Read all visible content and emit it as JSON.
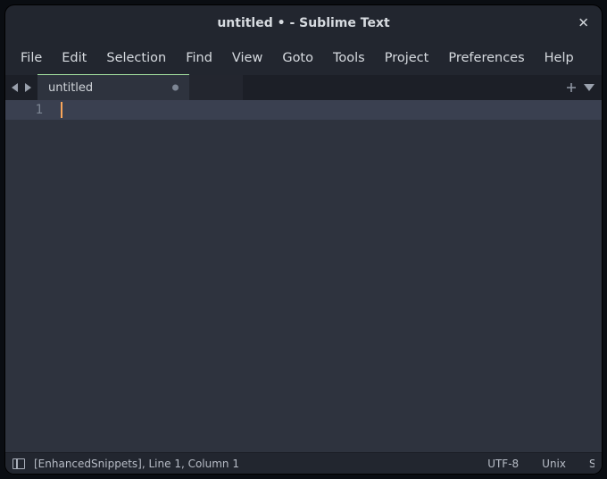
{
  "title": "untitled • - Sublime Text",
  "menu": {
    "items": [
      "File",
      "Edit",
      "Selection",
      "Find",
      "View",
      "Goto",
      "Tools",
      "Project",
      "Preferences",
      "Help"
    ]
  },
  "tabs": {
    "items": [
      {
        "label": "untitled",
        "dirty": true,
        "active": true
      }
    ]
  },
  "editor": {
    "line_numbers": [
      "1"
    ],
    "content": ""
  },
  "status": {
    "snippets": "[EnhancedSnippets],",
    "position": "Line 1, Column 1",
    "encoding": "UTF-8",
    "line_endings": "Unix",
    "syntax_truncated": "S"
  },
  "colors": {
    "background": "#2e333e",
    "chrome": "#22262f",
    "tab_bg": "#2a2f3a",
    "current_line": "#3a4050",
    "caret": "#f9a65a",
    "tab_accent": "#a6e3a1"
  }
}
